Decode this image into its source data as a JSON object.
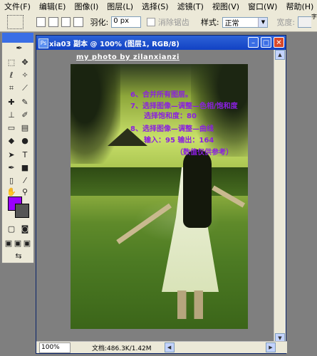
{
  "menubar": {
    "items": [
      "文件(F)",
      "编辑(E)",
      "图像(I)",
      "图层(L)",
      "选择(S)",
      "滤镜(T)",
      "视图(V)",
      "窗口(W)",
      "帮助(H)"
    ]
  },
  "optionsbar": {
    "feather_label": "羽化:",
    "feather_value": "0 px",
    "antialias_label": "消除锯齿",
    "style_label": "样式:",
    "style_value": "正常",
    "width_label": "宽度:",
    "edge_text": "字"
  },
  "toolbox": {
    "colors": {
      "foreground": "#9900ff",
      "background": "#555555"
    }
  },
  "document": {
    "title": "xia03 副本 @ 100% (图层1, RGB/8)",
    "watermark": "my photo by zilanxianzi",
    "notes": [
      "6、合并所有图层。",
      "7、选择图像—调整—色相/饱和度",
      "选择饱和度：80",
      "8、选择图像—调整—曲线",
      "输入：95  输出：164",
      "（数值仅供参考）"
    ],
    "zoom": "100%",
    "doc_info": "文档:486.3K/1.42M"
  }
}
